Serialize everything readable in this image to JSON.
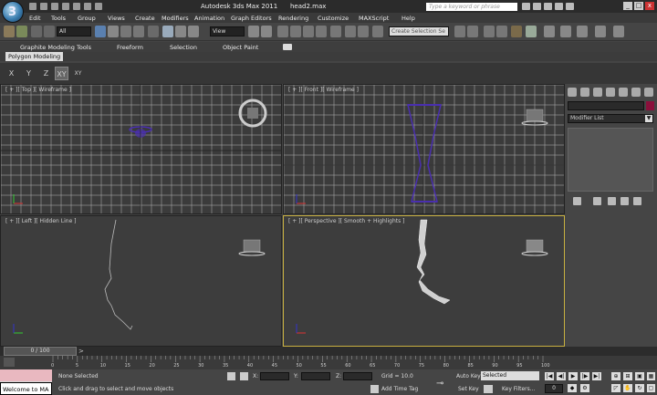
{
  "window": {
    "title": "Autodesk 3ds Max  2011",
    "file": "head2.max",
    "logo_letter": "3"
  },
  "search": {
    "placeholder": "Type a keyword or phrase"
  },
  "menu": [
    "Edit",
    "Tools",
    "Group",
    "Views",
    "Create",
    "Modifiers",
    "Animation",
    "Graph Editors",
    "Rendering",
    "Customize",
    "MAXScript",
    "Help"
  ],
  "toolbar": {
    "filter": "All",
    "ref_coord": "View",
    "selection_set": "Create Selection Se"
  },
  "ribbon": {
    "tabs": [
      "Graphite Modeling Tools",
      "Freeform",
      "Selection",
      "Object Paint"
    ],
    "panel": "Polygon Modeling"
  },
  "axis_constraints": [
    "X",
    "Y",
    "Z",
    "XY",
    "XY"
  ],
  "viewports": {
    "top": "[ + ][ Top ][ Wireframe ]",
    "front": "[ + ][ Front ][ Wireframe ]",
    "left": "[ + ][ Left ][ Hidden Line ]",
    "perspective": "[ + ][ Perspective ][ Smooth + Highlights ]"
  },
  "command_panel": {
    "modifier_list": "Modifier List",
    "swatch_color": "#8b0f3b"
  },
  "timeline": {
    "frame": "0 / 100",
    "ticks": [
      "0",
      "5",
      "10",
      "15",
      "20",
      "25",
      "30",
      "35",
      "40",
      "45",
      "50",
      "55",
      "60",
      "65",
      "70",
      "75",
      "80",
      "85",
      "90",
      "95",
      "100"
    ]
  },
  "status": {
    "selection": "None Selected",
    "prompt": "Click and drag to select and move objects",
    "x_label": "X:",
    "y_label": "Y:",
    "z_label": "Z:",
    "grid": "Grid = 10.0",
    "add_time_tag": "Add Time Tag",
    "auto_key": "Auto Key",
    "key_mode": "Selected",
    "set_key": "Set Key",
    "key_filters": "Key Filters...",
    "current_frame": "0",
    "listener": "Welcome to MA"
  },
  "colors": {
    "viewport_bg": "#3b3b3b",
    "grid": "#b8b8b8",
    "selection_wire": "#4a2fb0",
    "active_viewport_border": "#c8b040"
  }
}
